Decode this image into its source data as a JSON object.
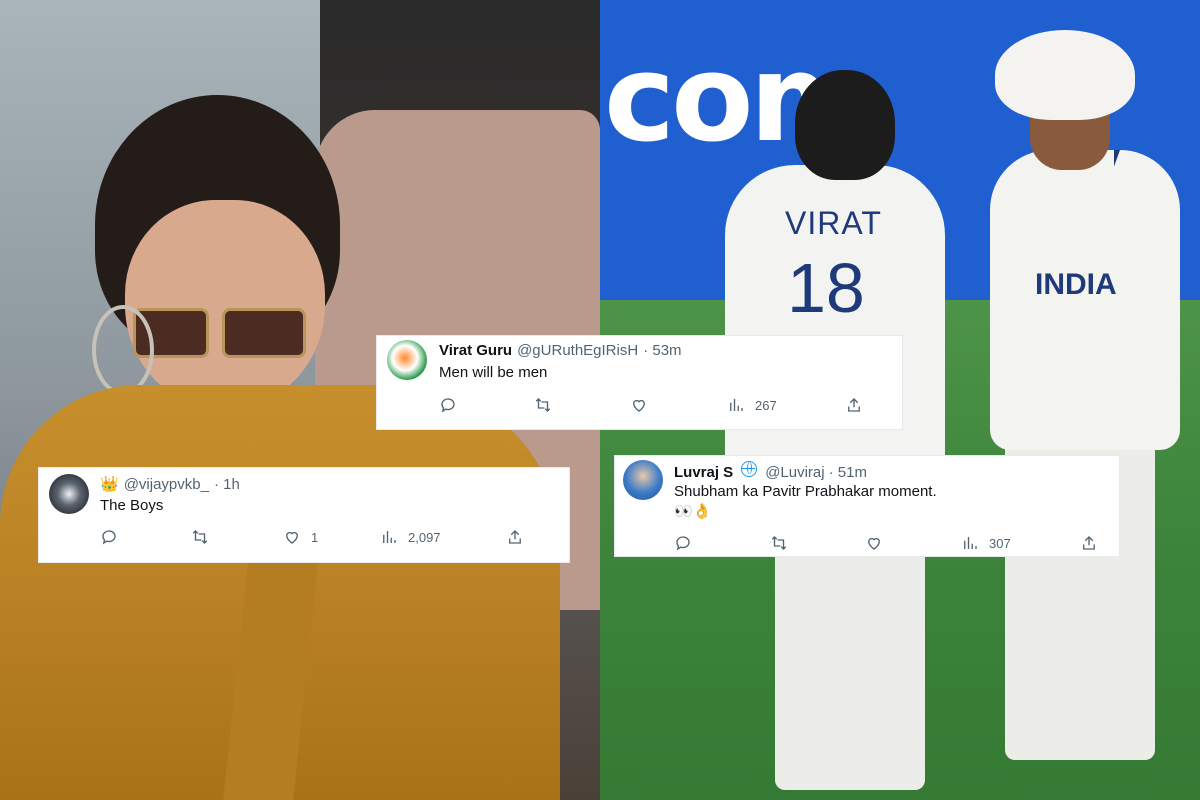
{
  "tweets": {
    "virat_guru": {
      "name": "Virat Guru",
      "handle": "@gURuthEgIRisH",
      "time": "· 53m",
      "text": "Men will be men",
      "views": "267"
    },
    "vijay": {
      "prefix_emoji": "👑",
      "handle": "@vijaypvkb_",
      "time": "· 1h",
      "text": "The Boys",
      "likes": "1",
      "views": "2,097"
    },
    "luvraj": {
      "name": "Luvraj S",
      "handle": "@Luviraj",
      "time": "· 51m",
      "text": "Shubham ka Pavitr Prabhakar moment.",
      "emoji_line": "👀👌",
      "views": "307"
    }
  },
  "photo": {
    "board_text": "com",
    "jersey_name": "VIRAT",
    "jersey_number": "18",
    "jersey_team": "INDIA"
  },
  "icons": [
    "reply-icon",
    "retweet-icon",
    "like-icon",
    "views-icon",
    "share-icon",
    "verified-globe-icon",
    "crown-icon"
  ],
  "colors": {
    "accent": "#1d9bf0",
    "text": "#0f1419",
    "muted": "#536471"
  }
}
